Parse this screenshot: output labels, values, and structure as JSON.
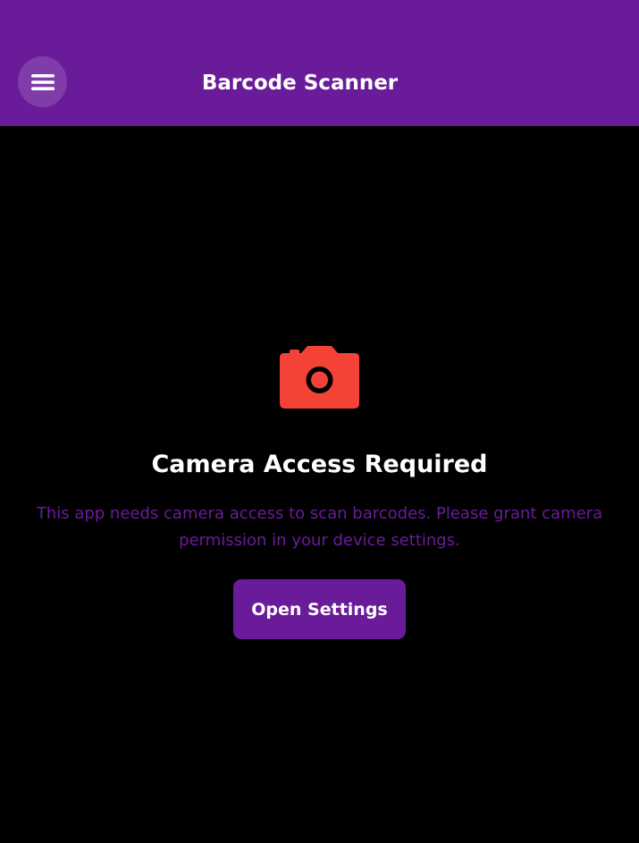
{
  "header": {
    "title": "Barcode Scanner",
    "menu_icon": "hamburger-menu-icon",
    "background_color": "#6A1B9A"
  },
  "permission": {
    "icon": "camera-icon",
    "icon_color": "#F44336",
    "title": "Camera Access Required",
    "description": "This app needs camera access to scan barcodes. Please grant camera permission in your device settings.",
    "button_label": "Open Settings"
  },
  "colors": {
    "accent": "#6A1B9A",
    "background": "#000000",
    "error": "#F44336"
  }
}
